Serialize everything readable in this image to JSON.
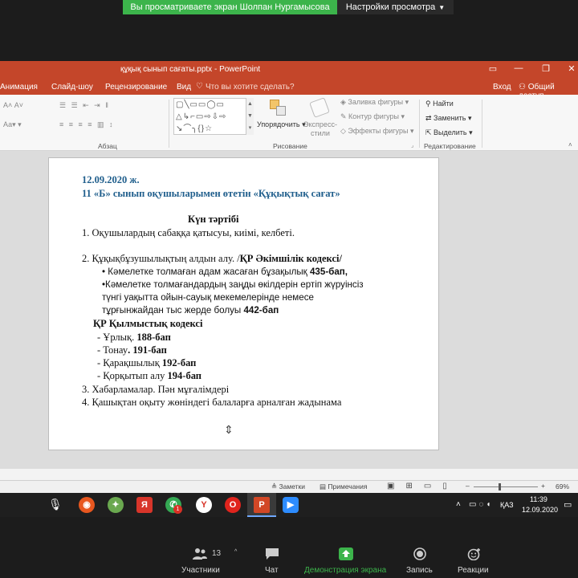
{
  "zoom": {
    "share_banner": "Вы просматриваете экран Шолпан Нургамысова",
    "view_settings": "Настройки просмотра",
    "participants_count": "13",
    "toolbar": [
      {
        "label": "Участники",
        "icon": "participants-icon"
      },
      {
        "label": "Чат",
        "icon": "chat-icon"
      },
      {
        "label": "Демонстрация экрана",
        "icon": "share-screen-icon"
      },
      {
        "label": "Запись",
        "icon": "record-icon"
      },
      {
        "label": "Реакции",
        "icon": "reactions-icon"
      }
    ],
    "accent_green": "#3cb44b"
  },
  "ppt": {
    "title": "құқық сынып сағаты.pptx - PowerPoint",
    "tabs": [
      "Анимация",
      "Слайд-шоу",
      "Рецензирование",
      "Вид"
    ],
    "tell_me": "Что вы хотите сделать?",
    "login": "Вход",
    "share": "Общий доступ",
    "brand_color": "#c4462a",
    "ribbon": {
      "paragraph_group": "Абзац",
      "drawing_group": "Рисование",
      "editing_group": "Редактирование",
      "arrange": "Упорядочить",
      "quick_styles": "Экспресс-стили",
      "shape_fill": "Заливка фигуры",
      "shape_outline": "Контур фигуры",
      "shape_effects": "Эффекты фигуры",
      "find": "Найти",
      "replace": "Заменить",
      "select": "Выделить"
    },
    "slide": {
      "date": "12.09.2020 ж.",
      "subtitle": "11 «Б» сынып оқушыларымен өтетін «Құқықтық сағат»",
      "agenda_title": "Күн тәртібі",
      "item1": "1.   Оқушылардың сабаққа қатысуы, киімі, келбеті.",
      "item2_text": "2.   Құқықбұзушылықтың алдын алу. /",
      "item2_bold": "ҚР Әкімшілік кодексі",
      "item2_end": "/",
      "sub1_text": "• Кәмелетке толмаған адам жасаған бұзақылық ",
      "sub1_bold": "435-бап,",
      "sub2_line1": "•Кәмелетке толмағандардың заңды өкілдерін ертіп жүруінсіз",
      "sub2_line2": "түнгі уақытта ойын-сауық мекемелерінде  немесе",
      "sub2_line3_text": "тұрғынжайдан тыс жерде болуы ",
      "sub2_line3_bold": "442-бап",
      "criminal_code": "ҚР Қылмыстық кодексі",
      "crime1_text": "- Ұрлық. ",
      "crime1_bold": "188-бап",
      "crime2_text": "- Тонау",
      "crime2_bold": ". 191-бап",
      "crime3_text": "- Қарақшылық  ",
      "crime3_bold": "192-бап",
      "crime4_text": "- Қорқытып алу    ",
      "crime4_bold": "194-бап",
      "item3": "3.   Хабарламалар. Пән мұғалімдері",
      "item4": "4.   Қашықтан оқыту жөніндегі балаларға арналған жадынама"
    },
    "status": {
      "notes": "Заметки",
      "comments": "Примечания",
      "zoom_level": "69%"
    }
  },
  "taskbar": {
    "lang": "ҚАЗ",
    "time": "11:39",
    "date": "12.09.2020",
    "whatsapp_badge": "1"
  }
}
